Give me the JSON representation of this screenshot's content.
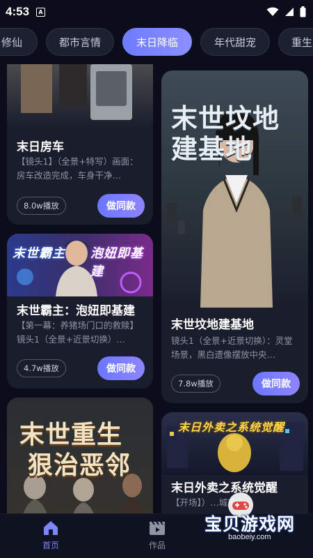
{
  "status_bar": {
    "time": "4:53",
    "app_icon": "A"
  },
  "tabs": [
    {
      "label": "修仙",
      "active": false
    },
    {
      "label": "都市言情",
      "active": false
    },
    {
      "label": "末日降临",
      "active": true
    },
    {
      "label": "年代甜宠",
      "active": false
    },
    {
      "label": "重生",
      "active": false
    }
  ],
  "cards": [
    {
      "title": "末日房车",
      "desc": "【镜头1】（全景+特写）画面：房车改造完成，车身干净…",
      "plays": "8.0w播放",
      "button": "做同款"
    },
    {
      "title": "末世坟地建基地",
      "poster_text": [
        "末世坟地",
        "建基地"
      ],
      "desc": "镜头1（全景+近景切换）：灵堂场景，黑白遗像摆放中央…",
      "plays": "7.8w播放",
      "button": "做同款"
    },
    {
      "title": "末世霸主：泡妞即基建",
      "poster_text": [
        "末世霸主",
        "泡妞即基建"
      ],
      "desc": "【第一幕：养猪场门口的救赎】镜头1（全景+近景切换）…",
      "plays": "4.7w播放",
      "button": "做同款"
    },
    {
      "title": "末日外卖之系统觉醒",
      "poster_text": [
        "末日外卖之系统觉醒"
      ],
      "desc": "【开场】）…城市大",
      "plays": "",
      "button": ""
    },
    {
      "title": "",
      "poster_text": [
        "末世重生",
        "狠治恶邻"
      ],
      "desc": "",
      "plays": "",
      "button": ""
    }
  ],
  "bottom_nav": [
    {
      "label": "首页",
      "icon": "home-icon",
      "active": true
    },
    {
      "label": "作品",
      "icon": "clapperboard-icon",
      "active": false
    }
  ],
  "watermark": {
    "title": "宝贝游戏网",
    "url": "baobeiy.com"
  },
  "colors": {
    "background": "#0b0e1a",
    "card": "#1a1e2c",
    "accent": "#7b86ff",
    "muted_text": "#8e93a6"
  }
}
